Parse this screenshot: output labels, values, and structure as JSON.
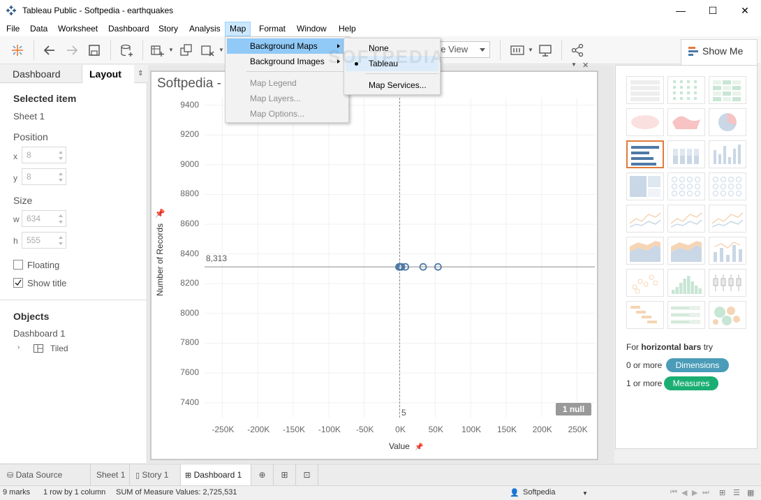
{
  "window": {
    "title": "Tableau Public - Softpedia - earthquakes",
    "minimize": "—",
    "maximize": "☐",
    "close": "✕"
  },
  "menubar": [
    "File",
    "Data",
    "Worksheet",
    "Dashboard",
    "Story",
    "Analysis",
    "Map",
    "Format",
    "Window",
    "Help"
  ],
  "toolbar": {
    "view_select": "re View"
  },
  "show_me": {
    "label": "Show Me",
    "hint_prefix": "For ",
    "hint_bold": "horizontal bars",
    "hint_suffix": " try",
    "dim_prefix": "0 or more",
    "dim_label": "Dimensions",
    "meas_prefix": "1 or more",
    "meas_label": "Measures",
    "dim_color": "#4a9cb8",
    "meas_color": "#1aae73"
  },
  "left_panel": {
    "tab_dashboard": "Dashboard",
    "tab_layout": "Layout",
    "tab_more": "⇕",
    "selected_item_header": "Selected item",
    "selected_item": "Sheet 1",
    "position_header": "Position",
    "x_label": "x",
    "x_value": "8",
    "y_label": "y",
    "y_value": "8",
    "size_header": "Size",
    "w_label": "w",
    "w_value": "634",
    "h_label": "h",
    "h_value": "555",
    "floating_label": "Floating",
    "floating_checked": false,
    "show_title_label": "Show title",
    "show_title_checked": true,
    "objects_header": "Objects",
    "objects_root": "Dashboard 1",
    "objects_child": "Tiled"
  },
  "sheet": {
    "title": "Softpedia -",
    "ref_line_label": "8,313",
    "x_ref_label": "5",
    "null_badge": "1 null"
  },
  "chart_data": {
    "type": "scatter",
    "xlabel": "Value",
    "ylabel": "Number of Records",
    "xlim": [
      -275000,
      275000
    ],
    "ylim": [
      7300,
      9450
    ],
    "x_ticks": [
      "-250K",
      "-200K",
      "-150K",
      "-100K",
      "-50K",
      "0K",
      "50K",
      "100K",
      "150K",
      "200K",
      "250K"
    ],
    "x_tick_values": [
      -250000,
      -200000,
      -150000,
      -100000,
      -50000,
      0,
      50000,
      100000,
      150000,
      200000,
      250000
    ],
    "y_ticks": [
      "9400",
      "9200",
      "9000",
      "8800",
      "8600",
      "8400",
      "8200",
      "8000",
      "7800",
      "7600",
      "7400"
    ],
    "y_tick_values": [
      9400,
      9200,
      9000,
      8800,
      8600,
      8400,
      8200,
      8000,
      7800,
      7600,
      7400
    ],
    "reference_y": 8313,
    "reference_x": 5,
    "points": [
      {
        "x": -1000,
        "y": 8313
      },
      {
        "x": 0,
        "y": 8313
      },
      {
        "x": 1000,
        "y": 8313
      },
      {
        "x": 2500,
        "y": 8313
      },
      {
        "x": 8000,
        "y": 8313
      },
      {
        "x": 33000,
        "y": 8313
      },
      {
        "x": 54000,
        "y": 8313
      }
    ],
    "point_color": "#4e79a7",
    "grid": true
  },
  "bottom_tabs": {
    "data_source": "Data Source",
    "sheet1": "Sheet 1",
    "story1": "Story 1",
    "dashboard1": "Dashboard 1"
  },
  "status": {
    "marks": "9 marks",
    "rows": "1 row by 1 column",
    "sum": "SUM of Measure Values: 2,725,531",
    "user": "Softpedia"
  },
  "map_menu": {
    "background_maps": "Background Maps",
    "background_images": "Background Images",
    "map_legend": "Map Legend",
    "map_layers": "Map Layers...",
    "map_options": "Map Options..."
  },
  "bg_submenu": {
    "none": "None",
    "tableau": "Tableau",
    "map_services": "Map Services..."
  },
  "watermark": "SOFTPEDIA"
}
